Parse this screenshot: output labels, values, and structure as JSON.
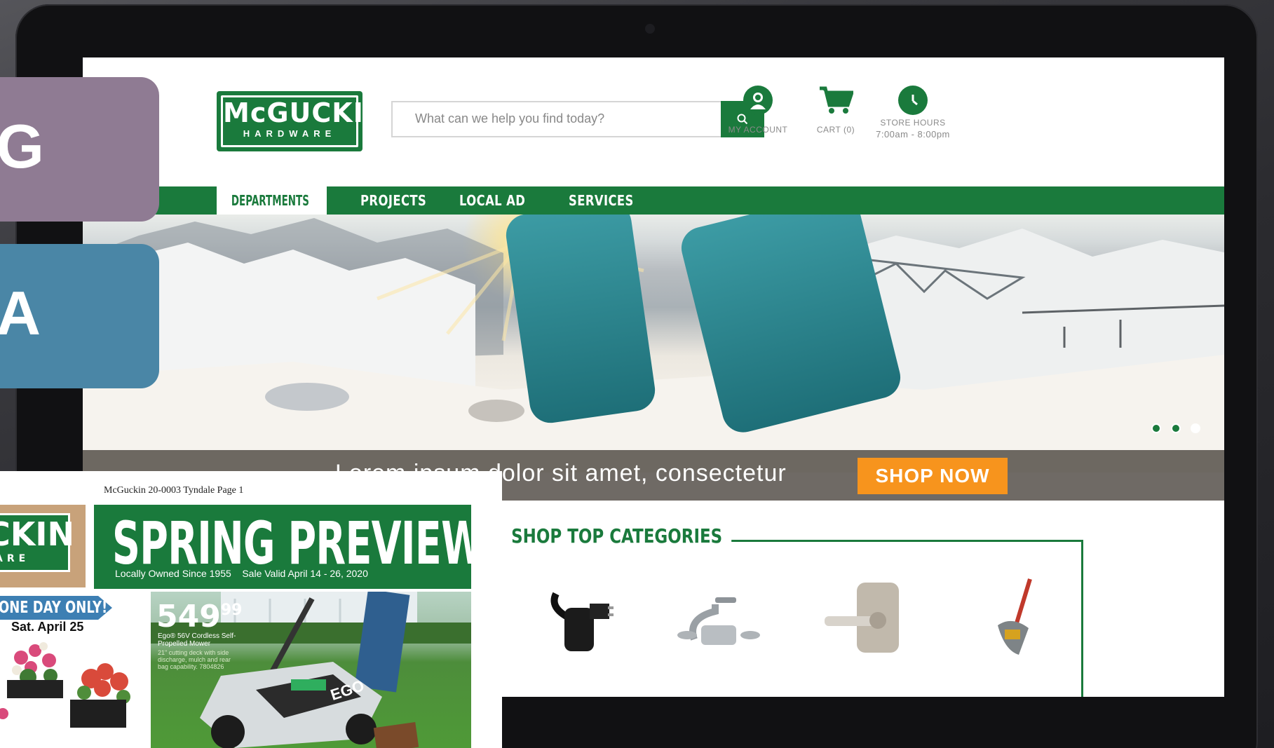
{
  "header": {
    "logo_name": "McGUCKIN",
    "logo_sub": "HARDWARE",
    "search_placeholder": "What can we help you find today?",
    "account_label": "MY ACCOUNT",
    "cart_label": "CART (0)",
    "hours_label": "STORE HOURS",
    "hours_value": "7:00am - 8:00pm"
  },
  "nav": {
    "items": [
      {
        "label": "DEPARTMENTS"
      },
      {
        "label": "PROJECTS"
      },
      {
        "label": "LOCAL AD"
      },
      {
        "label": "SERVICES"
      }
    ]
  },
  "hero": {
    "caption": "Lorem ipsum dolor sit amet, consectetur",
    "cta": "SHOP NOW",
    "slides_total": 3,
    "slide_active": 2
  },
  "categories": {
    "title": "SHOP TOP CATEGORIES",
    "items": [
      "extension-cord",
      "faucet",
      "door-lever",
      "shovel"
    ]
  },
  "side_tabs": [
    {
      "letters": "IG",
      "color": "#8f7b93"
    },
    {
      "letters": "IA",
      "color": "#4a86a6"
    }
  ],
  "flyer": {
    "caption": "McGuckin 20-0003 Tyndale Page 1",
    "logo_letters": "CKIN",
    "logo_sub": "ARE",
    "headline": "SPRING PREVIEW",
    "tagline_left": "Locally Owned Since 1955",
    "tagline_right": "Sale Valid April 14 - 26, 2020",
    "oneday": "ONE DAY ONLY!",
    "oneday_date": "Sat. April 25",
    "price_main": "549",
    "price_cents": "99",
    "product_title": "Ego® 56V Cordless Self-Propelled Mower",
    "product_desc": "21\" cutting deck with side discharge, mulch and rear bag capability. 7804826",
    "mower_brand": "EGO"
  },
  "colors": {
    "brand_green": "#1a7a3c",
    "cta_orange": "#f7941d",
    "tab_purple": "#8f7b93",
    "tab_blue": "#4a86a6"
  }
}
